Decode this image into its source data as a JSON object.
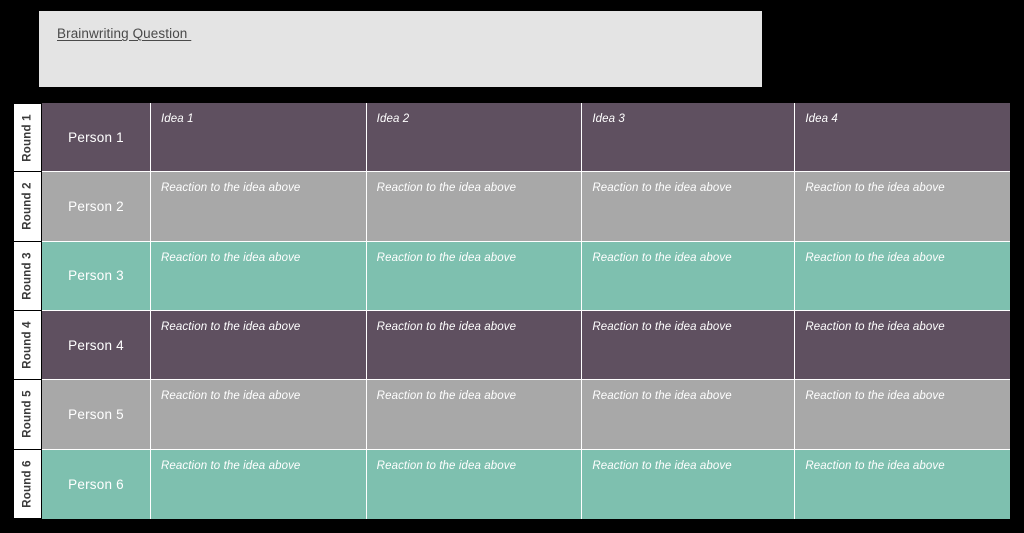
{
  "page": {
    "background_color": "#000000"
  },
  "question_box": {
    "title": "Brainwriting Question ",
    "background_color": "#E4E4E4",
    "text_color": "#4A4A4A"
  },
  "table": {
    "row_label_header": "Round",
    "column_headers": [
      "Idea 1",
      "Idea 2",
      "Idea 3",
      "Idea 4"
    ],
    "reaction_text": "Reaction to the idea above",
    "themes": {
      "purple": "#5F5060",
      "gray": "#A8A8A8",
      "teal": "#7EC0AF",
      "gridline": "#FFFFFF",
      "round_label_bg": "#FFFFFF",
      "round_label_color": "#3A3A3A"
    },
    "rows": [
      {
        "round": "Round 1",
        "person": "Person 1",
        "theme": "purple",
        "cells": [
          "Idea 1",
          "Idea 2",
          "Idea 3",
          "Idea 4"
        ]
      },
      {
        "round": "Round 2",
        "person": "Person 2",
        "theme": "gray",
        "cells": [
          "Reaction to the idea above",
          "Reaction to the idea above",
          "Reaction to the idea above",
          "Reaction to the idea above"
        ]
      },
      {
        "round": "Round 3",
        "person": "Person 3",
        "theme": "teal",
        "cells": [
          "Reaction to the idea above",
          "Reaction to the idea above",
          "Reaction to the idea above",
          "Reaction to the idea above"
        ]
      },
      {
        "round": "Round 4",
        "person": "Person 4",
        "theme": "purple",
        "cells": [
          "Reaction to the idea above",
          "Reaction to the idea above",
          "Reaction to the idea above",
          "Reaction to the idea above"
        ]
      },
      {
        "round": "Round 5",
        "person": "Person 5",
        "theme": "gray",
        "cells": [
          "Reaction to the idea above",
          "Reaction to the idea above",
          "Reaction to the idea above",
          "Reaction to the idea above"
        ]
      },
      {
        "round": "Round 6",
        "person": "Person 6",
        "theme": "teal",
        "cells": [
          "Reaction to the idea above",
          "Reaction to the idea above",
          "Reaction to the idea above",
          "Reaction to the idea above"
        ]
      }
    ]
  }
}
